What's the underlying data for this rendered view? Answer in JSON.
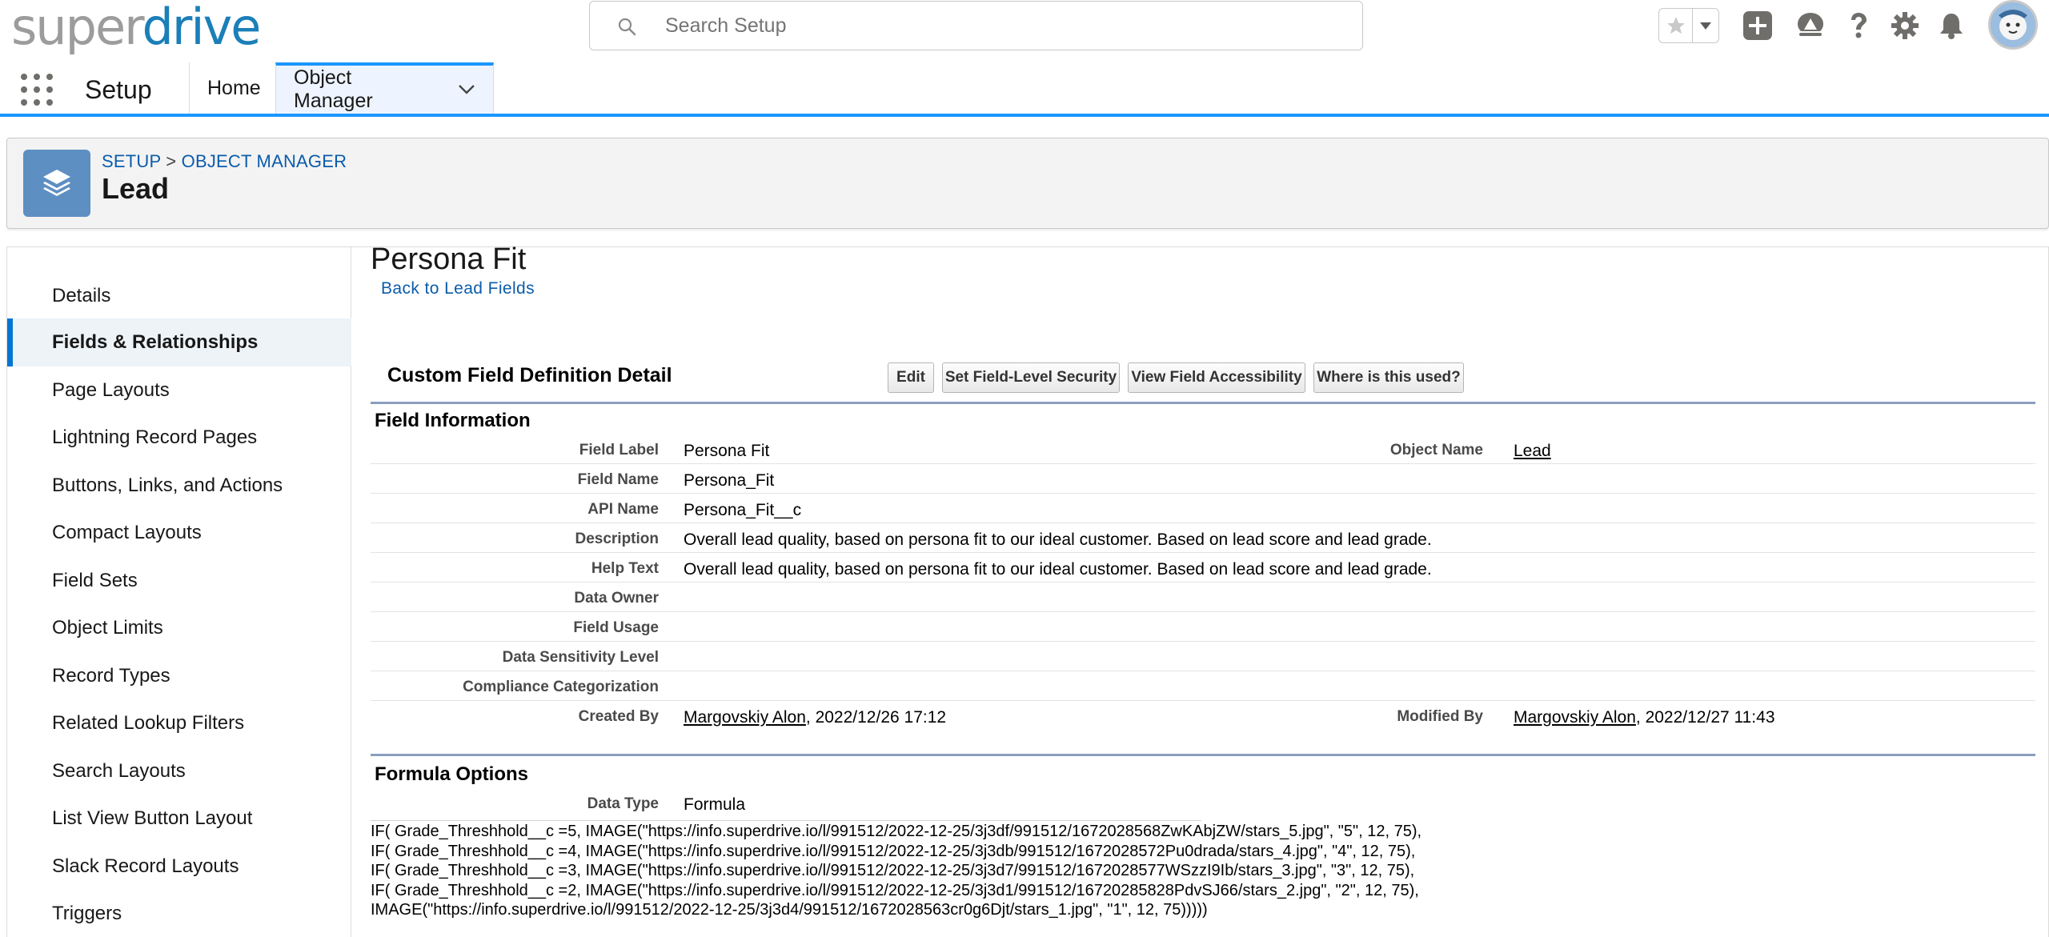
{
  "logo": {
    "part1": "super",
    "part2": "drive"
  },
  "search": {
    "placeholder": "Search Setup"
  },
  "header_icons": [
    "favorites-star-icon",
    "favorites-dropdown-icon",
    "add-icon",
    "trailhead-icon",
    "help-icon",
    "setup-gear-icon",
    "notifications-bell-icon",
    "avatar"
  ],
  "app_nav": {
    "app_name": "Setup",
    "tabs": [
      {
        "label": "Home"
      },
      {
        "label": "Object Manager"
      }
    ]
  },
  "object_header": {
    "crumb_setup": "SETUP",
    "crumb_sep": ">",
    "crumb_object_manager": "OBJECT MANAGER",
    "title": "Lead"
  },
  "sidebar": {
    "items": [
      {
        "label": "Details"
      },
      {
        "label": "Fields & Relationships"
      },
      {
        "label": "Page Layouts"
      },
      {
        "label": "Lightning Record Pages"
      },
      {
        "label": "Buttons, Links, and Actions"
      },
      {
        "label": "Compact Layouts"
      },
      {
        "label": "Field Sets"
      },
      {
        "label": "Object Limits"
      },
      {
        "label": "Record Types"
      },
      {
        "label": "Related Lookup Filters"
      },
      {
        "label": "Search Layouts"
      },
      {
        "label": "List View Button Layout"
      },
      {
        "label": "Slack Record Layouts"
      },
      {
        "label": "Triggers"
      }
    ],
    "active_index": 1
  },
  "page": {
    "title": "Persona Fit",
    "back_link": "Back to Lead Fields",
    "detail_title": "Custom Field Definition Detail",
    "buttons": {
      "edit": "Edit",
      "field_level_security": "Set Field-Level Security",
      "view_field_accessibility": "View Field Accessibility",
      "where_used": "Where is this used?"
    }
  },
  "field_information": {
    "heading": "Field Information",
    "field_label": {
      "label": "Field Label",
      "value": "Persona Fit"
    },
    "object_name": {
      "label": "Object Name",
      "value": "Lead"
    },
    "field_name": {
      "label": "Field Name",
      "value": "Persona_Fit"
    },
    "api_name": {
      "label": "API Name",
      "value": "Persona_Fit__c"
    },
    "description": {
      "label": "Description",
      "value": "Overall lead quality, based on persona fit to our ideal customer. Based on lead score and lead grade."
    },
    "help_text": {
      "label": "Help Text",
      "value": "Overall lead quality, based on persona fit to our ideal customer. Based on lead score and lead grade."
    },
    "data_owner": {
      "label": "Data Owner",
      "value": ""
    },
    "field_usage": {
      "label": "Field Usage",
      "value": ""
    },
    "data_sensitivity": {
      "label": "Data Sensitivity Level",
      "value": ""
    },
    "compliance": {
      "label": "Compliance Categorization",
      "value": ""
    },
    "created_by": {
      "label": "Created By",
      "user": "Margovskiy Alon",
      "date": ", 2022/12/26 17:12"
    },
    "modified_by": {
      "label": "Modified By",
      "user": "Margovskiy Alon",
      "date": ", 2022/12/27 11:43"
    }
  },
  "formula_options": {
    "heading": "Formula Options",
    "data_type": {
      "label": "Data Type",
      "value": "Formula"
    },
    "formula_lines": [
      "IF( Grade_Threshhold__c =5, IMAGE(\"https://info.superdrive.io/l/991512/2022-12-25/3j3df/991512/1672028568ZwKAbjZW/stars_5.jpg\", \"5\", 12, 75),",
      "IF( Grade_Threshhold__c =4, IMAGE(\"https://info.superdrive.io/l/991512/2022-12-25/3j3db/991512/1672028572Pu0drada/stars_4.jpg\", \"4\", 12, 75),",
      "IF( Grade_Threshhold__c =3, IMAGE(\"https://info.superdrive.io/l/991512/2022-12-25/3j3d7/991512/1672028577WSzzI9Ib/stars_3.jpg\", \"3\", 12, 75),",
      "IF( Grade_Threshhold__c =2, IMAGE(\"https://info.superdrive.io/l/991512/2022-12-25/3j3d1/991512/16720285828PdvSJ66/stars_2.jpg\", \"2\", 12, 75),",
      "IMAGE(\"https://info.superdrive.io/l/991512/2022-12-25/3j3d4/991512/1672028563cr0g6Djt/stars_1.jpg\", \"1\", 12, 75)))))"
    ]
  },
  "colors": {
    "brand_blue": "#1b7fb8",
    "nav_accent": "#1b96ff",
    "link": "#0b5cab",
    "object_icon": "#5d8fc2"
  }
}
